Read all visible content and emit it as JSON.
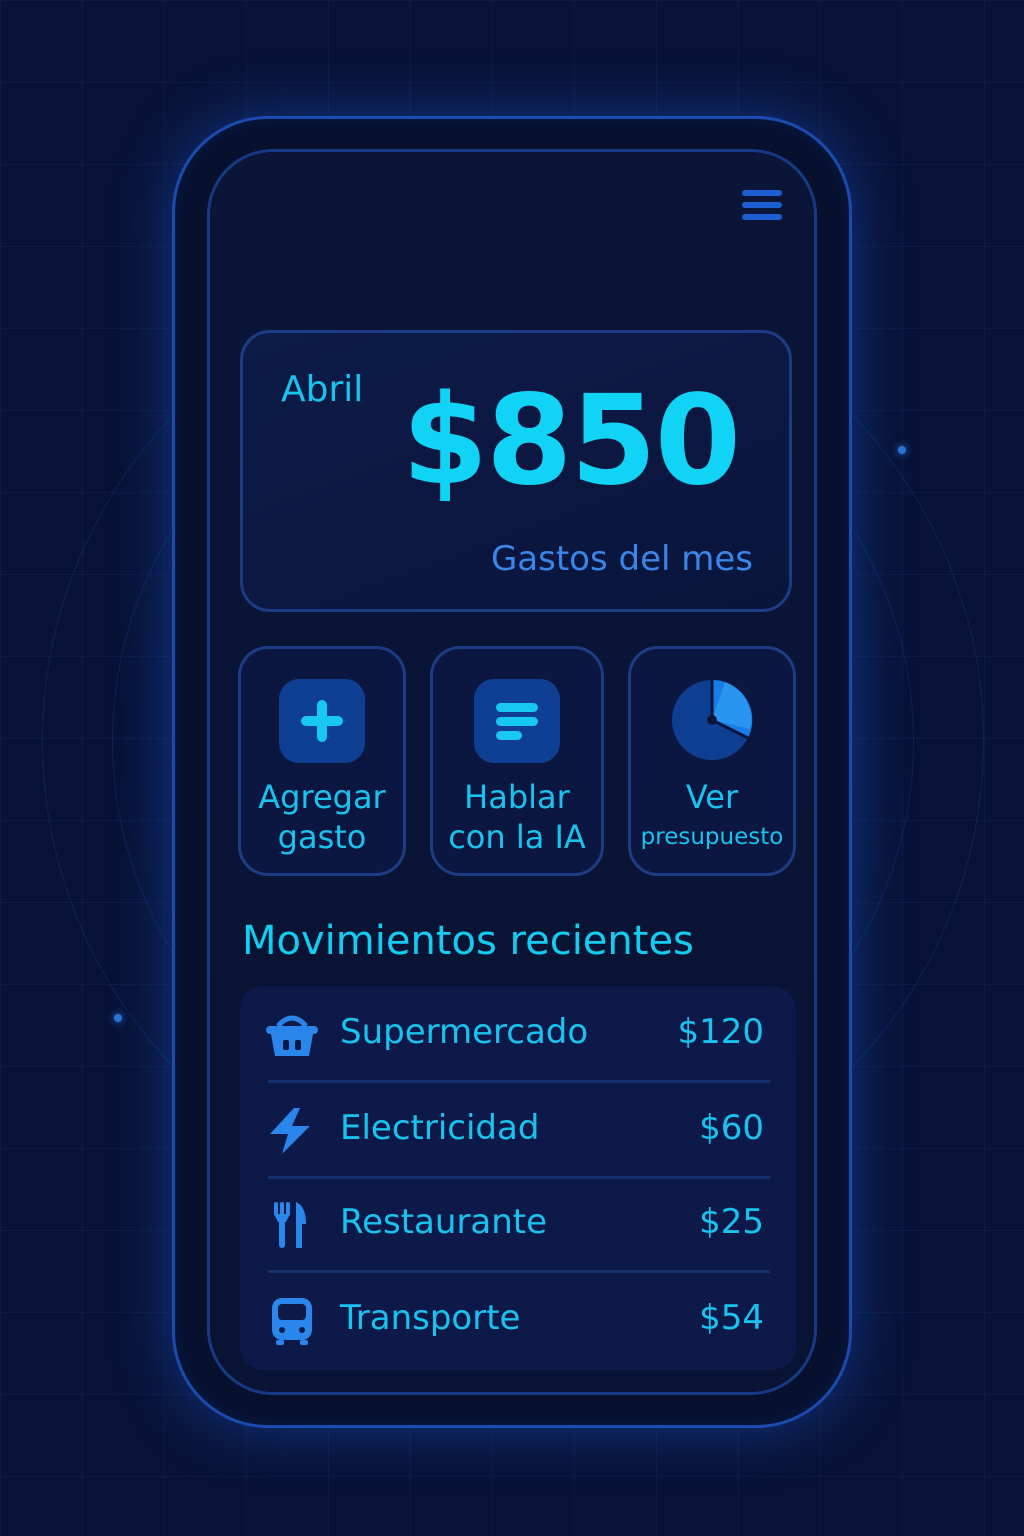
{
  "summary": {
    "month": "Abril",
    "amount": "$850",
    "label": "Gastos del mes"
  },
  "actions": [
    {
      "line1": "Agregar",
      "line2": "gasto",
      "icon": "plus-icon"
    },
    {
      "line1": "Hablar",
      "line2": "con la IA",
      "icon": "chat-lines-icon"
    },
    {
      "line1": "Ver",
      "line2": "presupuesto",
      "icon": "pie-chart-icon"
    }
  ],
  "recent": {
    "title": "Movimientos recientes",
    "items": [
      {
        "label": "Supermercado",
        "amount": "$120",
        "icon": "basket-icon"
      },
      {
        "label": "Electricidad",
        "amount": "$60",
        "icon": "lightning-icon"
      },
      {
        "label": "Restaurante",
        "amount": "$25",
        "icon": "cutlery-icon"
      },
      {
        "label": "Transporte",
        "amount": "$54",
        "icon": "bus-icon"
      }
    ]
  },
  "colors": {
    "accent": "#10d3f5",
    "secondary": "#3a86e8",
    "background": "#081236",
    "border": "#1c3d86"
  }
}
